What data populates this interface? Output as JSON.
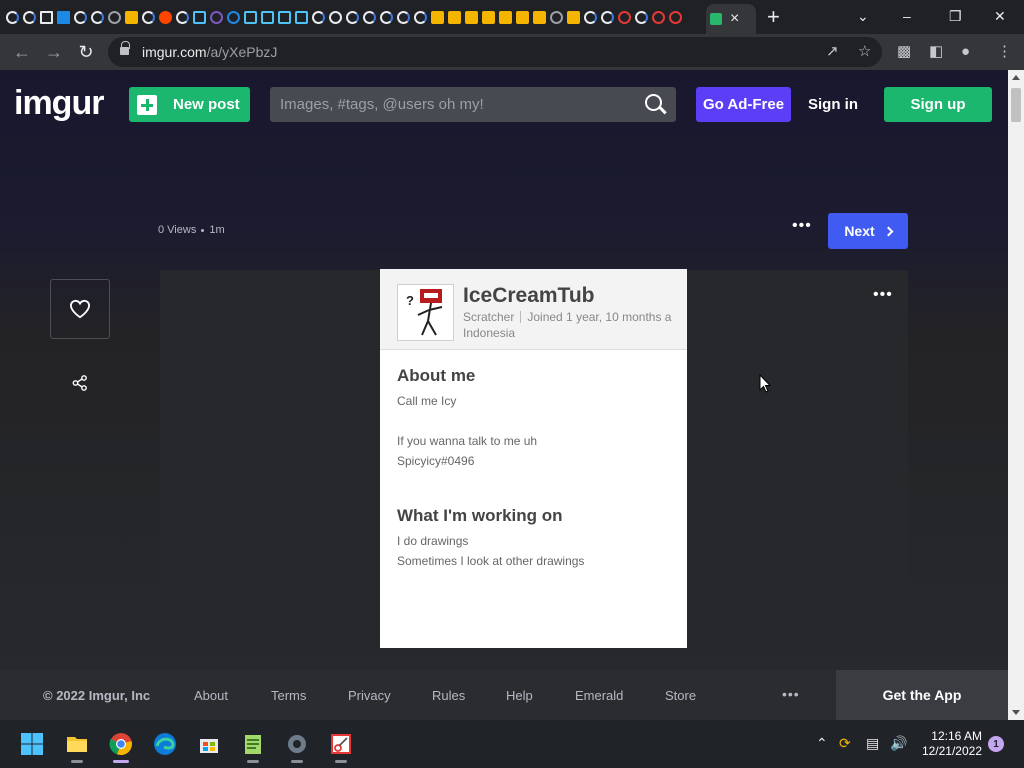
{
  "browser": {
    "active_tab_close": "×",
    "new_tab": "+",
    "window_controls": {
      "dropdown": "⌄",
      "minimize": "–",
      "maximize": "❐",
      "close": "✕"
    },
    "url_host": "imgur.com",
    "url_path": "/a/yXePbzJ",
    "toolbar_icons": [
      "share-icon",
      "bookmark-star-icon",
      "extensions-icon",
      "side-panel-icon",
      "profile-icon",
      "menu-icon"
    ]
  },
  "imgur_header": {
    "logo": "imgur",
    "new_post": "New post",
    "search_placeholder": "Images, #tags, @users oh my!",
    "go_ad_free": "Go Ad-Free",
    "sign_in": "Sign in",
    "sign_up": "Sign up"
  },
  "post_meta": {
    "views": "0 Views",
    "age": "1m",
    "more": "•••",
    "next": "Next"
  },
  "profile_card": {
    "username": "IceCreamTub",
    "rank": "Scratcher",
    "joined": "Joined 1 year, 10 months a",
    "location": "Indonesia",
    "about_title": "About me",
    "about_line1": "Call me Icy",
    "about_line2": "If you wanna talk to me uh",
    "about_line3": "Spicyicy#0496",
    "working_title": "What I'm working on",
    "working_line1": "I do drawings",
    "working_line2": "Sometimes I look at other drawings"
  },
  "footer": {
    "copyright": "© 2022 Imgur, Inc",
    "links": [
      "About",
      "Terms",
      "Privacy",
      "Rules",
      "Help",
      "Emerald",
      "Store"
    ],
    "more": "•••",
    "get_app": "Get the App"
  },
  "taskbar": {
    "time": "12:16 AM",
    "date": "12/21/2022",
    "notification_count": "1",
    "apps": [
      "windows-start-icon",
      "file-explorer-icon",
      "chrome-icon",
      "edge-icon",
      "store-icon",
      "notepad-icon",
      "settings-icon",
      "snipping-tool-icon"
    ]
  },
  "colors": {
    "imgur_green": "#1bb76e",
    "ad_free_purple": "#5c3ef7",
    "next_blue": "#3f5bf2"
  }
}
